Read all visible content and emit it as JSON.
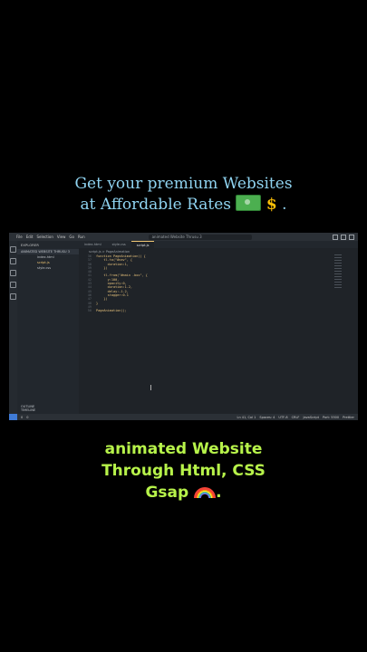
{
  "top_caption": {
    "line1": "Get your premium Websites",
    "line2": "at Affordable Rates",
    "dot": "."
  },
  "bottom_caption": {
    "line1": "animated Website",
    "line2": "Through Html, CSS",
    "line3": "Gsap",
    "dot": "."
  },
  "vscode": {
    "menu": [
      "File",
      "Edit",
      "Selection",
      "View",
      "Go",
      "Run"
    ],
    "window_title": "animated Website Thrusu 3",
    "explorer": {
      "header": "EXPLORER",
      "root": "ANIMATED WEBSITE THRUSU 3",
      "files": [
        "index.html",
        "script.js",
        "style.css"
      ],
      "bottom": [
        "OUTLINE",
        "TIMELINE"
      ]
    },
    "tabs": [
      "index.html",
      "style.css",
      "script.js"
    ],
    "breadcrumb": "script.js > PageAnimation",
    "code": [
      {
        "n": "36",
        "t": "function PageAnimation() {"
      },
      {
        "n": "37",
        "t": "    tl.to(\"#nav\", {"
      },
      {
        "n": "38",
        "t": "      duration:1,"
      },
      {
        "n": "39",
        "t": "    })"
      },
      {
        "n": "40",
        "t": ""
      },
      {
        "n": "41",
        "t": "    tl.from(\"#main .box\", {"
      },
      {
        "n": "42",
        "t": "      y:100,"
      },
      {
        "n": "43",
        "t": "      opacity:0,"
      },
      {
        "n": "44",
        "t": "      duration:1.2,"
      },
      {
        "n": "45",
        "t": "      delay:-1.2,"
      },
      {
        "n": "46",
        "t": "      stagger:0.1"
      },
      {
        "n": "47",
        "t": "    })"
      },
      {
        "n": "48",
        "t": "}"
      },
      {
        "n": "49",
        "t": ""
      },
      {
        "n": "50",
        "t": "PageAnimation();"
      }
    ],
    "status_left": [
      "0",
      "0"
    ],
    "status_right": [
      "Ln 41, Col 1",
      "Spaces: 4",
      "UTF-8",
      "CRLF",
      "JavaScript",
      "Port: 5500",
      "Prettier"
    ]
  }
}
